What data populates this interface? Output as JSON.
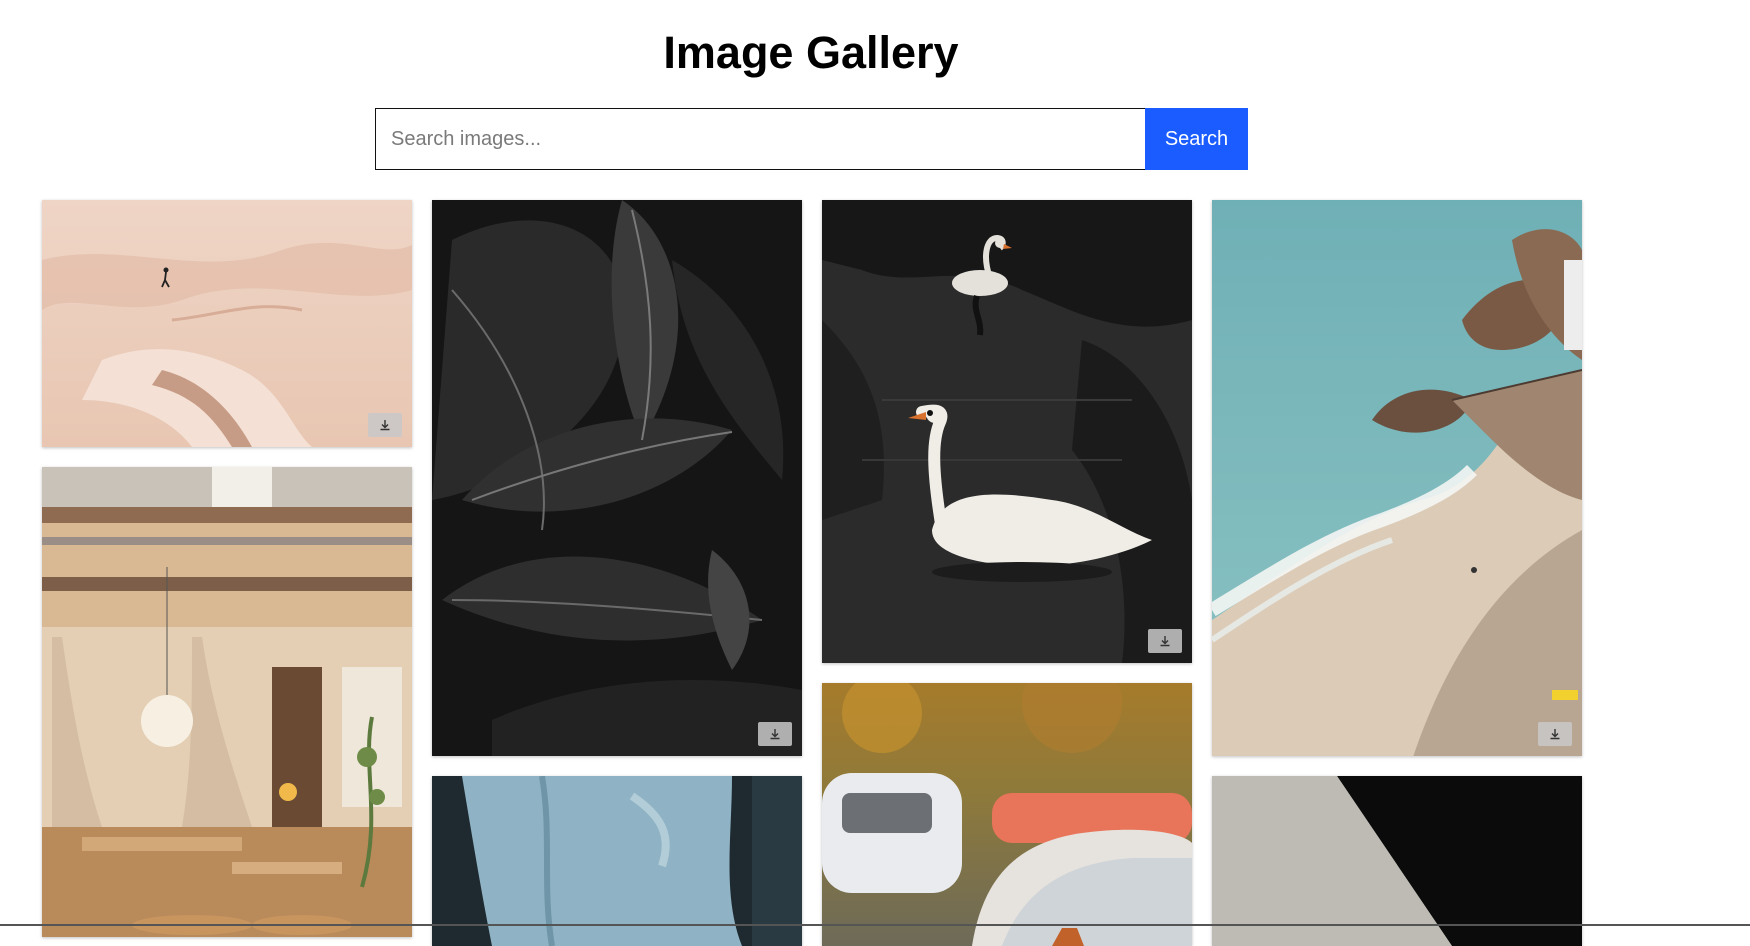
{
  "header": {
    "title": "Image Gallery"
  },
  "search": {
    "placeholder": "Search images...",
    "value": "",
    "button_label": "Search"
  },
  "gallery": {
    "images": [
      {
        "subject": "desert-walker",
        "has_download": true
      },
      {
        "subject": "restaurant-interior",
        "has_download": false
      },
      {
        "subject": "dark-leaves",
        "has_download": true
      },
      {
        "subject": "blue-fabric",
        "has_download": false
      },
      {
        "subject": "swans-on-dark-water",
        "has_download": true
      },
      {
        "subject": "parked-cars",
        "has_download": false
      },
      {
        "subject": "coastal-beach",
        "has_download": true
      },
      {
        "subject": "dark-abstract",
        "has_download": false
      }
    ],
    "download_icon": "download-icon"
  }
}
